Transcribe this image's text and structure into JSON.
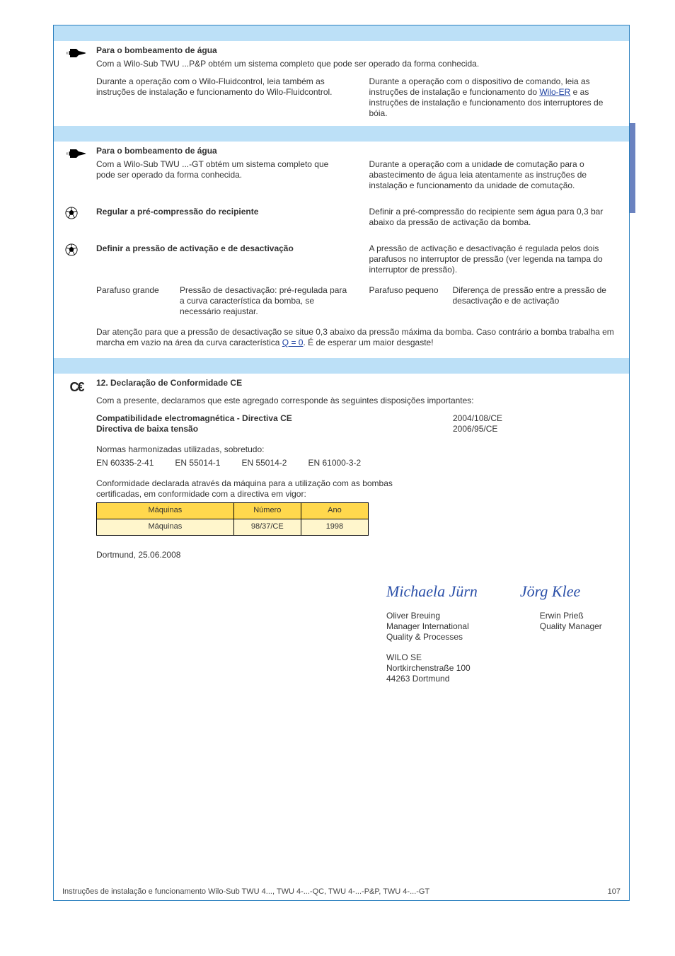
{
  "section1": {
    "heading_label": "Para o bombeamento de água",
    "p1": "Com a Wilo-Sub TWU ...P&P obtém um sistema completo que pode ser operado da forma conhecida.",
    "p2_a": "Durante a operação com o Wilo-Fluidcontrol, leia também as instruções de instalação e funcionamento do Wilo-Fluidcontrol.",
    "p2_b": "Durante a operação com o dispositivo de comando, leia as instruções de instalação e funcionamento do ",
    "p2_link": "Wilo-ER",
    "p2_c": " e as instruções de instalação e funcionamento dos interruptores de bóia."
  },
  "section2": {
    "heading_label": "Para o bombeamento de água",
    "p1": "Com a Wilo-Sub TWU ...-GT obtém um sistema completo que pode ser operado da forma conhecida.",
    "p2": "Durante a operação com a unidade de comutação para o abastecimento de água leia atentamente as instruções de instalação e funcionamento da unidade de comutação.",
    "p3_label": "Regular a pré-compressão do recipiente",
    "p3_body": "Definir a pré-compressão do recipiente sem água para 0,3 bar abaixo da pressão de activação da bomba.",
    "p4_label": "Definir a pressão de activação e de desactivação",
    "p4_body": "A pressão de activação e desactivação é regulada pelos dois parafusos no interruptor de pressão (ver legenda na tampa do interruptor de pressão).",
    "p4_b1_l": "Parafuso grande",
    "p4_b1_r": "Pressão de desactivação: pré-regulada para a curva característica da bomba, se necessário reajustar.",
    "p4_b2_l": "Parafuso pequeno",
    "p4_b2_r": "Diferença de pressão entre a pressão de desactivação e de activação",
    "p5_a": "Dar atenção para que a pressão de desactivação se situe 0,3 abaixo da pressão máxima da bomba. Caso contrário a bomba trabalha em marcha em vazio na área da curva característica ",
    "p5_link": "Q = 0",
    "p5_b": ". É de esperar um maior desgaste!"
  },
  "section3": {
    "heading_title": "12. Declaração de Conformidade CE",
    "p1": "Com a presente, declaramos que este agregado corresponde às seguintes disposições importantes:",
    "line_emc_l": "Compatibilidade electromagnética - Directiva CE",
    "line_emc_r": "2004/108/CE",
    "line_lv_l": "Directiva de baixa tensão",
    "line_lv_r": "2006/95/CE",
    "p2": "Normas harmonizadas utilizadas, sobretudo:",
    "std1": "EN 60335-2-41",
    "std2": "EN 55014-1",
    "std3": "EN 55014-2",
    "std4": "EN 61000-3-2",
    "p3": "Conformidade declarada através da máquina para a utilização com as bombas certificadas, em conformidade com a directiva em vigor:",
    "table": {
      "h1": "Máquinas",
      "h2": "Número",
      "h3": "Ano",
      "r1c1": "Máquinas",
      "r1c2": "98/37/CE",
      "r1c3": "1998"
    },
    "date": "Dortmund, 25.06.2008",
    "sig_left": "Michaela Jürn",
    "sig_right": "Jörg Klee",
    "name_left": "Oliver Breuing",
    "title_left": "Manager International",
    "title_left2": "Quality & Processes",
    "name_right": "Erwin Prieß",
    "title_right": "Quality Manager",
    "company": "WILO SE",
    "addr1": "Nortkirchenstraße 100",
    "addr2": "44263 Dortmund"
  },
  "footer": {
    "left": "Instruções de instalação e funcionamento Wilo-Sub TWU 4..., TWU 4-...-QC, TWU 4-...-P&P, TWU 4-...-GT",
    "right": "107"
  }
}
